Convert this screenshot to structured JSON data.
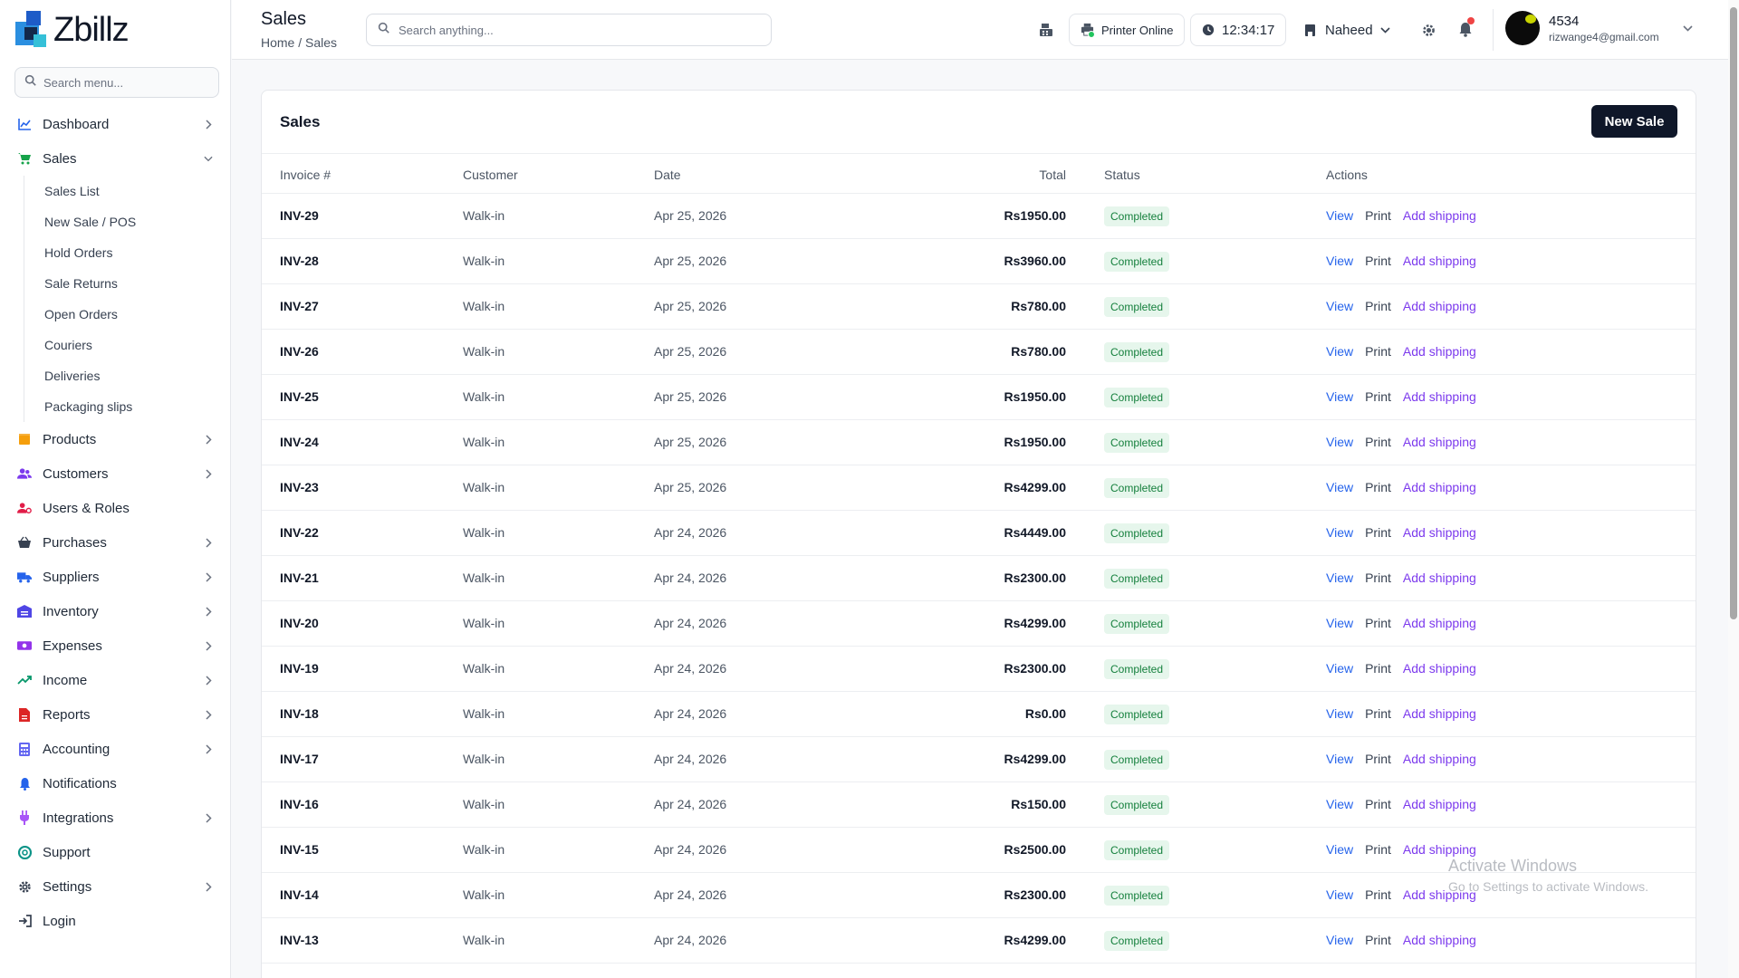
{
  "app": {
    "brand": "Zbillz"
  },
  "sidebar": {
    "search_placeholder": "Search menu...",
    "items": [
      {
        "label": "Dashboard",
        "icon": "chart-line-icon",
        "color": "#2563eb",
        "chevron": "right"
      },
      {
        "label": "Sales",
        "icon": "cart-icon",
        "color": "#16a34a",
        "chevron": "down"
      },
      {
        "label": "Products",
        "icon": "box-icon",
        "color": "#f59e0b",
        "chevron": "right"
      },
      {
        "label": "Customers",
        "icon": "users-icon",
        "color": "#7c3aed",
        "chevron": "right"
      },
      {
        "label": "Users & Roles",
        "icon": "user-cog-icon",
        "color": "#e11d48",
        "chevron": ""
      },
      {
        "label": "Purchases",
        "icon": "basket-icon",
        "color": "#374151",
        "chevron": "right"
      },
      {
        "label": "Suppliers",
        "icon": "truck-icon",
        "color": "#2563eb",
        "chevron": "right"
      },
      {
        "label": "Inventory",
        "icon": "warehouse-icon",
        "color": "#4f46e5",
        "chevron": "right"
      },
      {
        "label": "Expenses",
        "icon": "money-icon",
        "color": "#9333ea",
        "chevron": "right"
      },
      {
        "label": "Income",
        "icon": "trend-up-icon",
        "color": "#059669",
        "chevron": "right"
      },
      {
        "label": "Reports",
        "icon": "report-icon",
        "color": "#dc2626",
        "chevron": "right"
      },
      {
        "label": "Accounting",
        "icon": "calculator-icon",
        "color": "#6366f1",
        "chevron": "right"
      },
      {
        "label": "Notifications",
        "icon": "bell-icon",
        "color": "#2563eb",
        "chevron": ""
      },
      {
        "label": "Integrations",
        "icon": "plug-icon",
        "color": "#a855f7",
        "chevron": "right"
      },
      {
        "label": "Support",
        "icon": "lifebuoy-icon",
        "color": "#0d9488",
        "chevron": ""
      },
      {
        "label": "Settings",
        "icon": "gear-icon",
        "color": "#374151",
        "chevron": "right"
      },
      {
        "label": "Login",
        "icon": "login-icon",
        "color": "#374151",
        "chevron": ""
      }
    ],
    "sales_sub": [
      "Sales List",
      "New Sale / POS",
      "Hold Orders",
      "Sale Returns",
      "Open Orders",
      "Couriers",
      "Deliveries",
      "Packaging slips"
    ]
  },
  "header": {
    "title": "Sales",
    "breadcrumb": "Home / Sales",
    "search_placeholder": "Search anything...",
    "printer_status": "Printer Online",
    "clock": "12:34:17",
    "store_user": "Naheed",
    "profile_name": "4534",
    "profile_email": "rizwange4@gmail.com"
  },
  "card": {
    "title": "Sales",
    "new_button": "New Sale",
    "columns": [
      "Invoice #",
      "Customer",
      "Date",
      "Total",
      "Status",
      "Actions"
    ],
    "action_labels": [
      "View",
      "Print",
      "Add shipping"
    ],
    "rows": [
      {
        "invoice": "INV-29",
        "customer": "Walk-in",
        "date": "Apr 25, 2026",
        "total": "Rs1950.00",
        "status": "Completed"
      },
      {
        "invoice": "INV-28",
        "customer": "Walk-in",
        "date": "Apr 25, 2026",
        "total": "Rs3960.00",
        "status": "Completed"
      },
      {
        "invoice": "INV-27",
        "customer": "Walk-in",
        "date": "Apr 25, 2026",
        "total": "Rs780.00",
        "status": "Completed"
      },
      {
        "invoice": "INV-26",
        "customer": "Walk-in",
        "date": "Apr 25, 2026",
        "total": "Rs780.00",
        "status": "Completed"
      },
      {
        "invoice": "INV-25",
        "customer": "Walk-in",
        "date": "Apr 25, 2026",
        "total": "Rs1950.00",
        "status": "Completed"
      },
      {
        "invoice": "INV-24",
        "customer": "Walk-in",
        "date": "Apr 25, 2026",
        "total": "Rs1950.00",
        "status": "Completed"
      },
      {
        "invoice": "INV-23",
        "customer": "Walk-in",
        "date": "Apr 25, 2026",
        "total": "Rs4299.00",
        "status": "Completed"
      },
      {
        "invoice": "INV-22",
        "customer": "Walk-in",
        "date": "Apr 24, 2026",
        "total": "Rs4449.00",
        "status": "Completed"
      },
      {
        "invoice": "INV-21",
        "customer": "Walk-in",
        "date": "Apr 24, 2026",
        "total": "Rs2300.00",
        "status": "Completed"
      },
      {
        "invoice": "INV-20",
        "customer": "Walk-in",
        "date": "Apr 24, 2026",
        "total": "Rs4299.00",
        "status": "Completed"
      },
      {
        "invoice": "INV-19",
        "customer": "Walk-in",
        "date": "Apr 24, 2026",
        "total": "Rs2300.00",
        "status": "Completed"
      },
      {
        "invoice": "INV-18",
        "customer": "Walk-in",
        "date": "Apr 24, 2026",
        "total": "Rs0.00",
        "status": "Completed"
      },
      {
        "invoice": "INV-17",
        "customer": "Walk-in",
        "date": "Apr 24, 2026",
        "total": "Rs4299.00",
        "status": "Completed"
      },
      {
        "invoice": "INV-16",
        "customer": "Walk-in",
        "date": "Apr 24, 2026",
        "total": "Rs150.00",
        "status": "Completed"
      },
      {
        "invoice": "INV-15",
        "customer": "Walk-in",
        "date": "Apr 24, 2026",
        "total": "Rs2500.00",
        "status": "Completed"
      },
      {
        "invoice": "INV-14",
        "customer": "Walk-in",
        "date": "Apr 24, 2026",
        "total": "Rs2300.00",
        "status": "Completed"
      },
      {
        "invoice": "INV-13",
        "customer": "Walk-in",
        "date": "Apr 24, 2026",
        "total": "Rs4299.00",
        "status": "Completed"
      }
    ]
  },
  "watermark": {
    "line1": "Activate Windows",
    "line2": "Go to Settings to activate Windows."
  }
}
